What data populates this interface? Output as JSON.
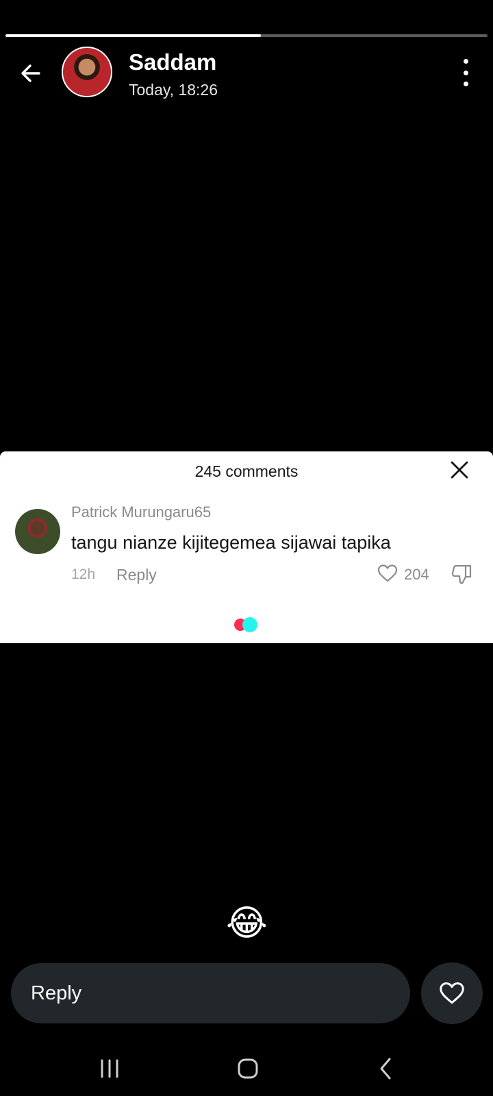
{
  "story": {
    "progress": 0.53,
    "author_name": "Saddam",
    "timestamp": "Today, 18:26"
  },
  "comments": {
    "count_label": "245 comments",
    "items": [
      {
        "username": "Patrick Murungaru65",
        "text": "tangu nianze kijitegemea sijawai tapika",
        "age": "12h",
        "reply_label": "Reply",
        "likes": "204"
      }
    ]
  },
  "emoji": "😂",
  "reply_bar": {
    "placeholder": "Reply"
  },
  "colors": {
    "background": "#000000",
    "panel": "#ffffff",
    "input_bg": "#22272c",
    "loader_red": "#fe2c55",
    "loader_cyan": "#25f4ee"
  },
  "icons": {
    "back": "arrow-left-icon",
    "more": "more-vertical-icon",
    "close": "close-icon",
    "like": "heart-outline-icon",
    "dislike": "thumbs-down-icon",
    "heart": "heart-outline-icon",
    "nav_recents": "recents-icon",
    "nav_home": "home-icon",
    "nav_back": "chevron-left-icon"
  }
}
